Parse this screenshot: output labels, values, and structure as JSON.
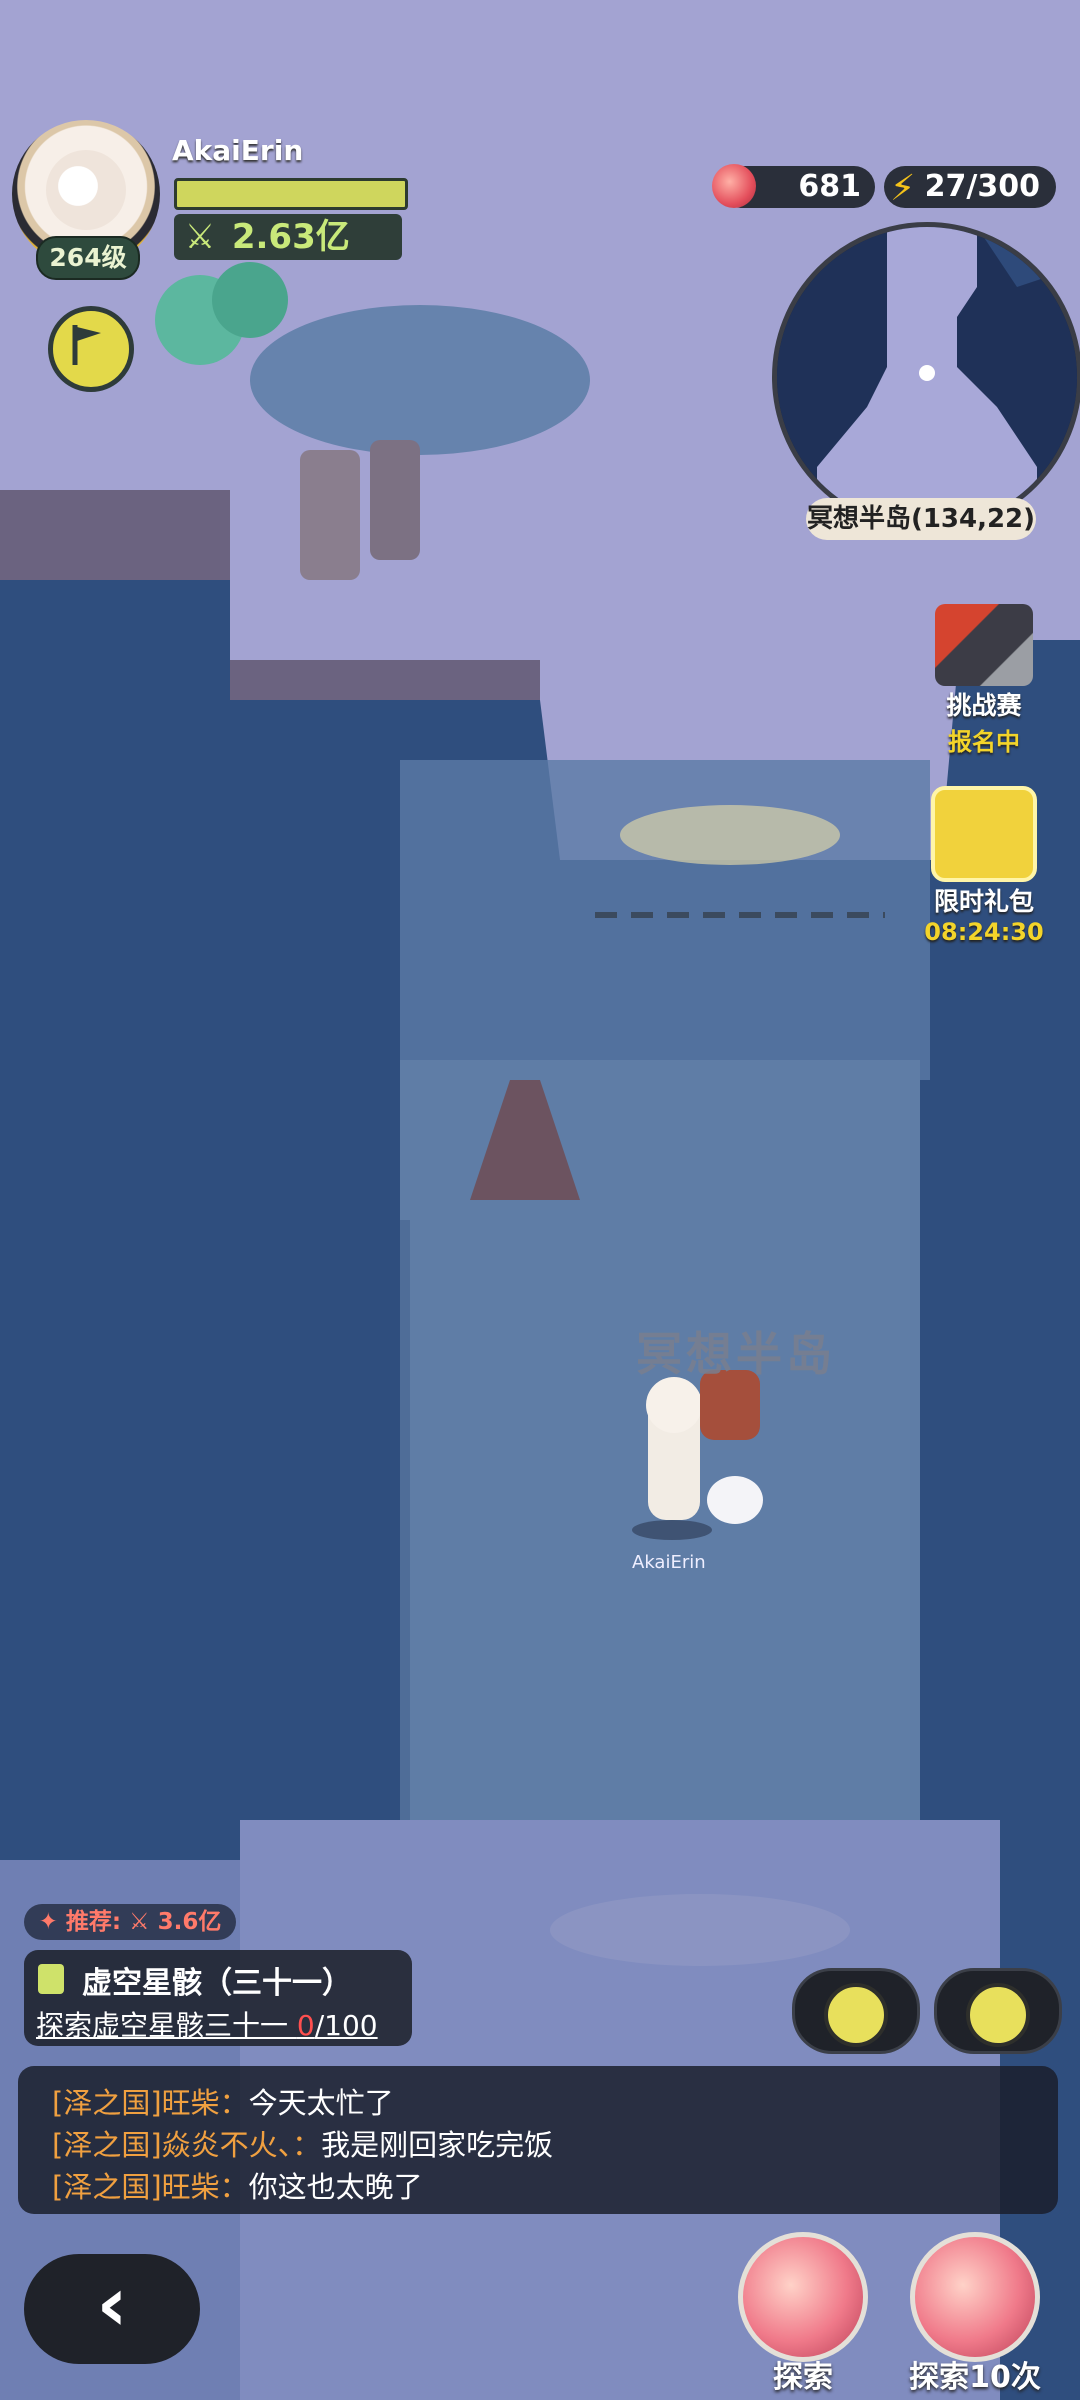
{
  "player": {
    "name": "AkaiErin",
    "level": "264级",
    "power_icon": "crossed-swords-icon",
    "power": "2.63亿"
  },
  "resources": {
    "apples": "681",
    "energy": "27",
    "energy_max": "/300"
  },
  "minimap": {
    "location": "冥想半岛(134,22)"
  },
  "side_buttons": {
    "challenge": {
      "title": "挑战赛",
      "status": "报名中"
    },
    "gift": {
      "title": "限时礼包",
      "timer": "08:24:30"
    }
  },
  "map": {
    "area_title": "冥想半岛",
    "character_name": "AkaiErin"
  },
  "quest": {
    "recommend": "✦ 推荐: ⚔ 3.6亿",
    "title": "虚空星骸（三十一）",
    "desc_prefix": "探索虚空星骸三十一 ",
    "progress_current": "0",
    "progress_total": "/100"
  },
  "chat": {
    "messages": [
      {
        "name": "[泽之国]旺柴：",
        "text": "今天太忙了"
      },
      {
        "name": "[泽之国]焱炎不火、：",
        "text": "我是刚回家吃完饭"
      },
      {
        "name": "[泽之国]旺柴：",
        "text": "你这也太晚了"
      }
    ]
  },
  "controls": {
    "back": "‹",
    "explore": "探索",
    "explore10": "探索10次"
  },
  "colors": {
    "water": "#2f4e7e",
    "land": "#9c9ccf",
    "accent_yellow": "#f3d42a",
    "chat_name": "#f0a040"
  }
}
